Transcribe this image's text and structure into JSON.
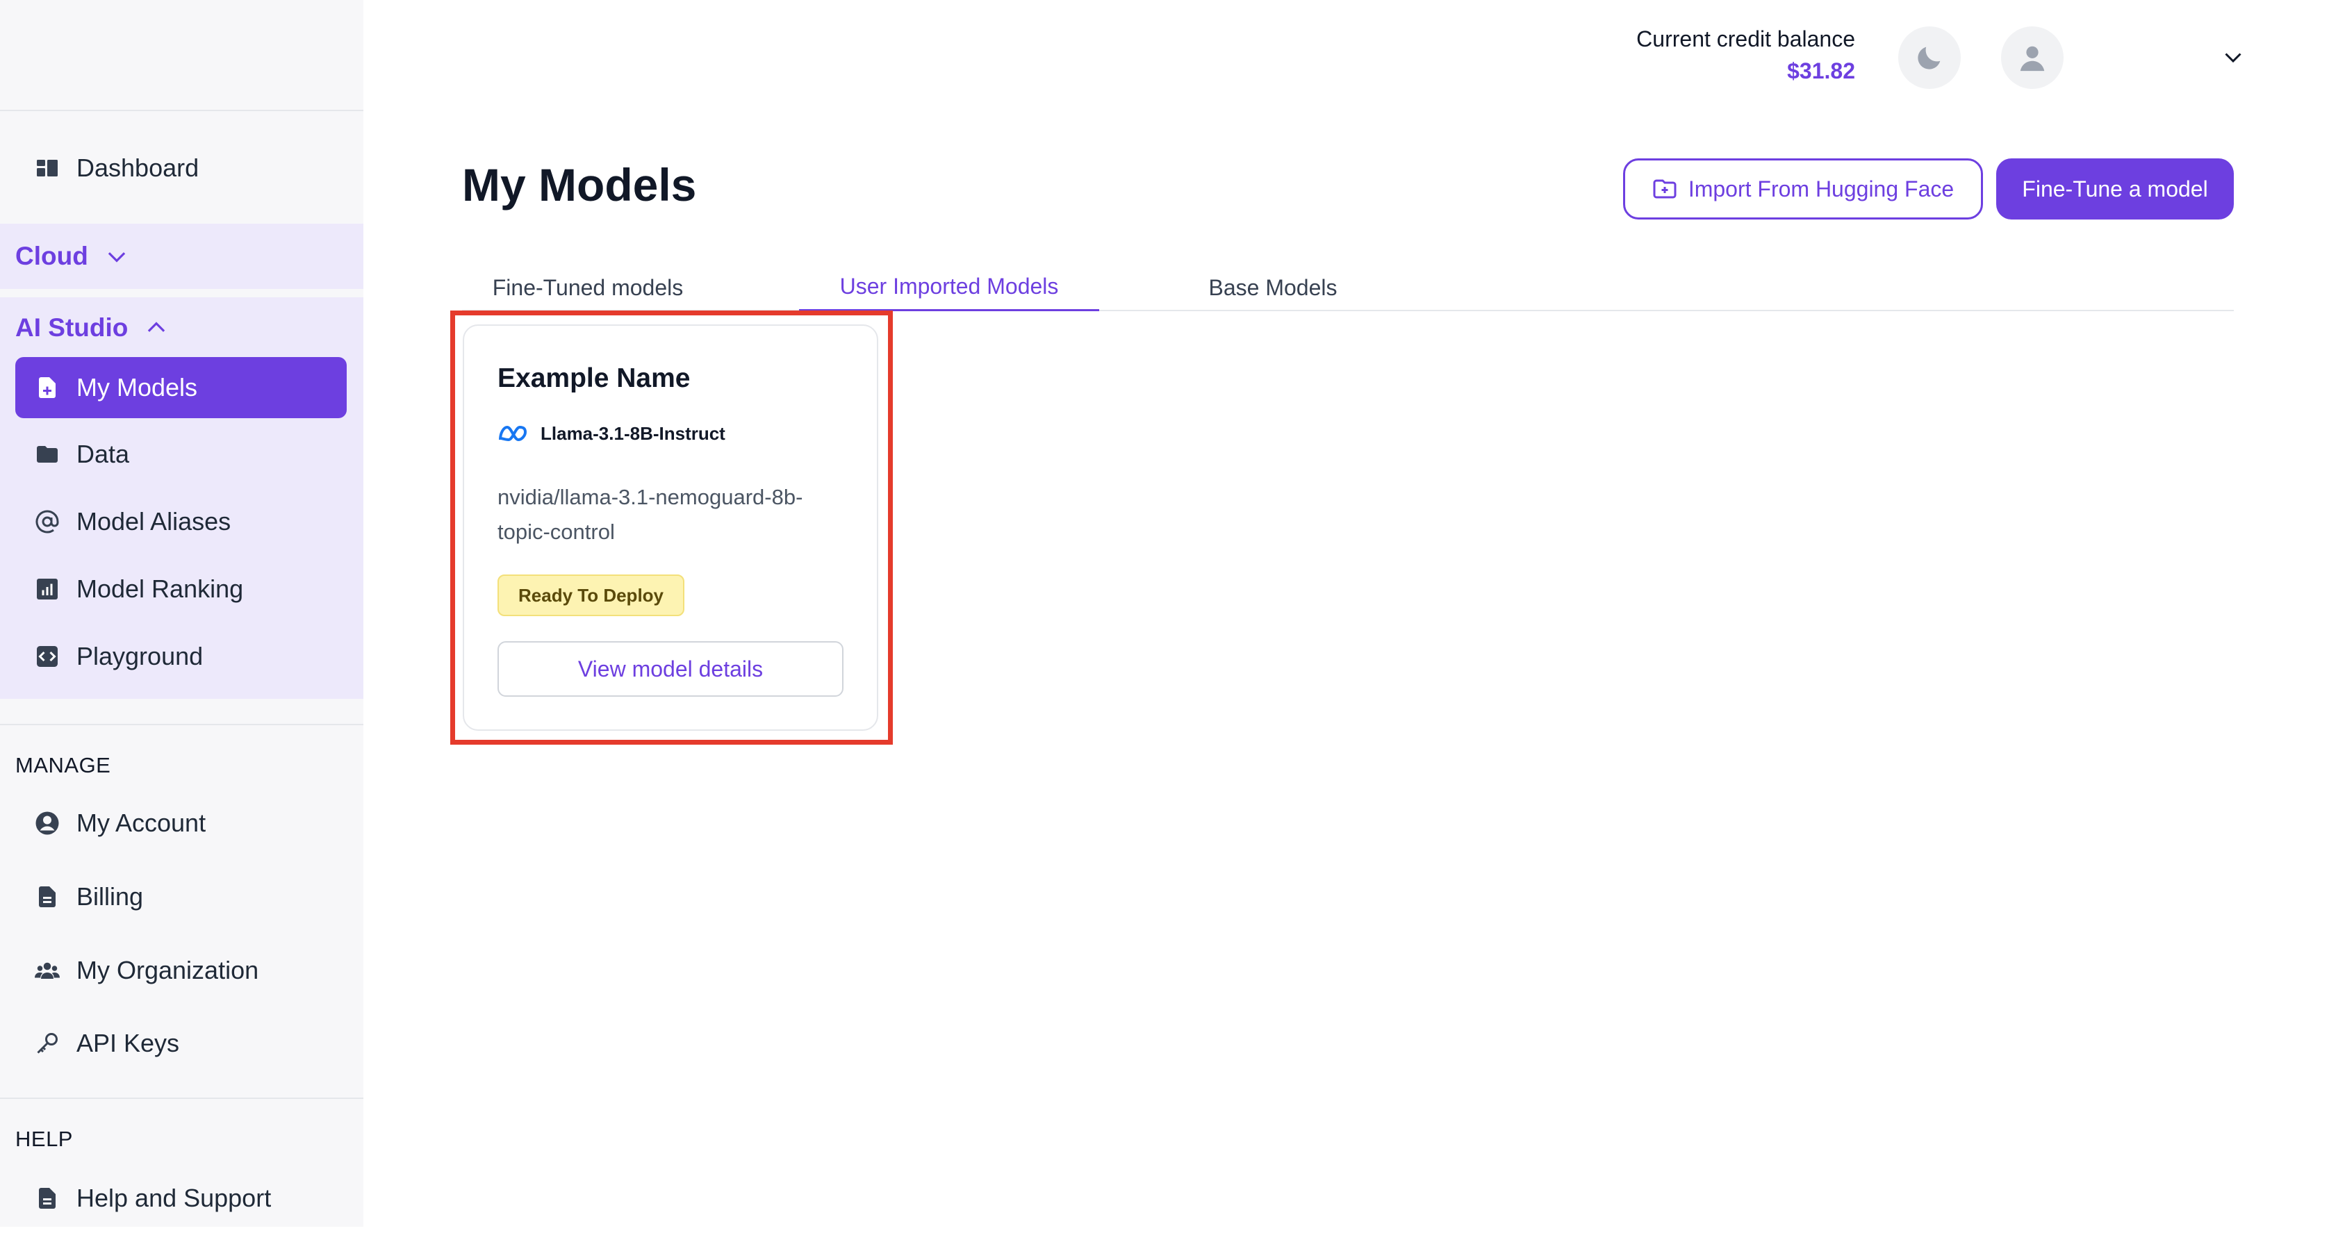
{
  "sidebar": {
    "dashboard": "Dashboard",
    "cloud": "Cloud",
    "ai_studio": "AI Studio",
    "ai_items": [
      "My Models",
      "Data",
      "Model Aliases",
      "Model Ranking",
      "Playground"
    ],
    "manage_label": "MANAGE",
    "manage_items": [
      "My Account",
      "Billing",
      "My Organization",
      "API Keys"
    ],
    "help_label": "HELP",
    "help_items": [
      "Help and Support"
    ]
  },
  "header": {
    "credit_label": "Current credit balance",
    "credit_value": "$31.82"
  },
  "main": {
    "title": "My Models",
    "import_button": "Import From Hugging Face",
    "finetune_button": "Fine-Tune a model",
    "tabs": [
      "Fine-Tuned models",
      "User Imported Models",
      "Base Models"
    ],
    "active_tab": "User Imported Models"
  },
  "card": {
    "name": "Example Name",
    "base_model": "Llama-3.1-8B-Instruct",
    "path": "nvidia/llama-3.1-nemoguard-8b-topic-control",
    "status": "Ready To Deploy",
    "details_button": "View model details"
  },
  "colors": {
    "accent": "#6d3fe0",
    "highlight": "#e53b2c",
    "badge": "#fdf3b2"
  }
}
